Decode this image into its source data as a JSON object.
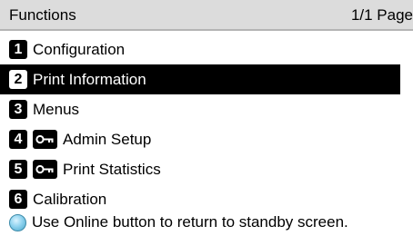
{
  "header": {
    "title": "Functions",
    "page_indicator": "1/1 Page"
  },
  "menu": {
    "items": [
      {
        "number": "1",
        "label": "Configuration",
        "locked": false,
        "selected": false
      },
      {
        "number": "2",
        "label": "Print Information",
        "locked": false,
        "selected": true
      },
      {
        "number": "3",
        "label": "Menus",
        "locked": false,
        "selected": false
      },
      {
        "number": "4",
        "label": "Admin Setup",
        "locked": true,
        "selected": false
      },
      {
        "number": "5",
        "label": "Print Statistics",
        "locked": true,
        "selected": false
      },
      {
        "number": "6",
        "label": "Calibration",
        "locked": false,
        "selected": false
      }
    ]
  },
  "footer": {
    "icon": "online-button-icon",
    "text": "Use Online button to return to standby screen."
  },
  "colors": {
    "header_bg": "#dcdcdc",
    "selected_bg": "#000000",
    "online_icon": "#8fd3ef"
  }
}
